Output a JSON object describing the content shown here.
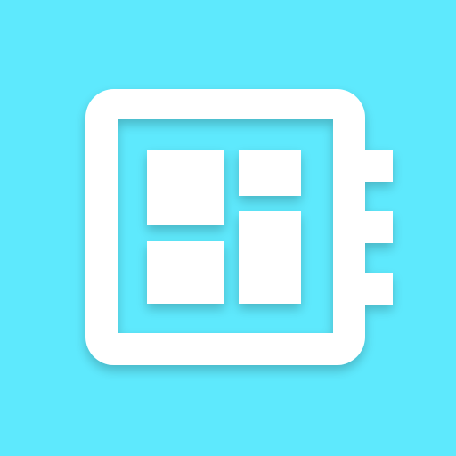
{
  "app": {
    "icon_name": "dashboard-notebook-icon",
    "colors": {
      "background": "#5ee9fd",
      "foreground": "#ffffff"
    }
  }
}
